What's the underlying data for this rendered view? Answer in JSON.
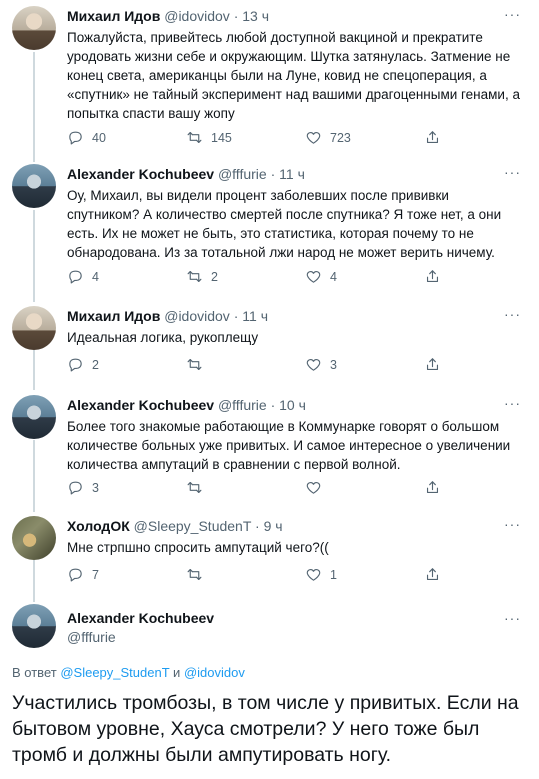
{
  "tweets": [
    {
      "name": "Михаил Идов",
      "handle": "@idovidov",
      "time": "13 ч",
      "text": "Пожалуйста, привейтесь любой доступной вакциной и прекратите уродовать жизни себе и окружающим. Шутка затянулась. Затмение не конец света, американцы были на Луне, ковид не спецоперация, а «спутник» не тайный эксперимент над вашими драгоценными генами, а попытка спасти вашу жопу",
      "replies": "40",
      "retweets": "145",
      "likes": "723"
    },
    {
      "name": "Alexander Kochubeev",
      "handle": "@fffurie",
      "time": "11 ч",
      "text": "Оу, Михаил, вы видели процент заболевших после прививки спутником? А количество смертей после спутника? Я тоже нет, а они есть. Их не может не быть, это статистика, которая почему то не обнародована. Из за тотальной лжи народ не может верить ничему.",
      "replies": "4",
      "retweets": "2",
      "likes": "4"
    },
    {
      "name": "Михаил Идов",
      "handle": "@idovidov",
      "time": "11 ч",
      "text": "Идеальная логика, рукоплещу",
      "replies": "2",
      "retweets": "",
      "likes": "3"
    },
    {
      "name": "Alexander Kochubeev",
      "handle": "@fffurie",
      "time": "10 ч",
      "text": "Более того знакомые работающие в Коммунарке говорят о большом количестве больных уже привитых. И самое интересное о увеличении количества ампутаций в сравнении с первой волной.",
      "replies": "3",
      "retweets": "",
      "likes": ""
    },
    {
      "name": "ХолодОК",
      "handle": "@Sleepy_StudenT",
      "time": "9 ч",
      "text": "Мне стрпшно спросить ампутаций чего?((",
      "replies": "7",
      "retweets": "",
      "likes": "1"
    }
  ],
  "main": {
    "name": "Alexander Kochubeev",
    "handle": "@fffurie",
    "reply_prefix": "В ответ",
    "reply_user1": "@Sleepy_StudenT",
    "reply_and": "и",
    "reply_user2": "@idovidov",
    "text": "Участились тромбозы, в том числе у привитых. Если на бытовом уровне, Хауса смотрели? У него тоже был тромб и должны были ампутировать ногу."
  },
  "colors": {
    "accent": "#1d9bf0",
    "secondary_text": "#536471",
    "primary_text": "#0f1419",
    "thread_line": "#cfd9de"
  },
  "icons": {
    "reply": "reply-icon",
    "retweet": "retweet-icon",
    "like": "heart-icon",
    "share": "share-icon",
    "more": "more-icon"
  }
}
